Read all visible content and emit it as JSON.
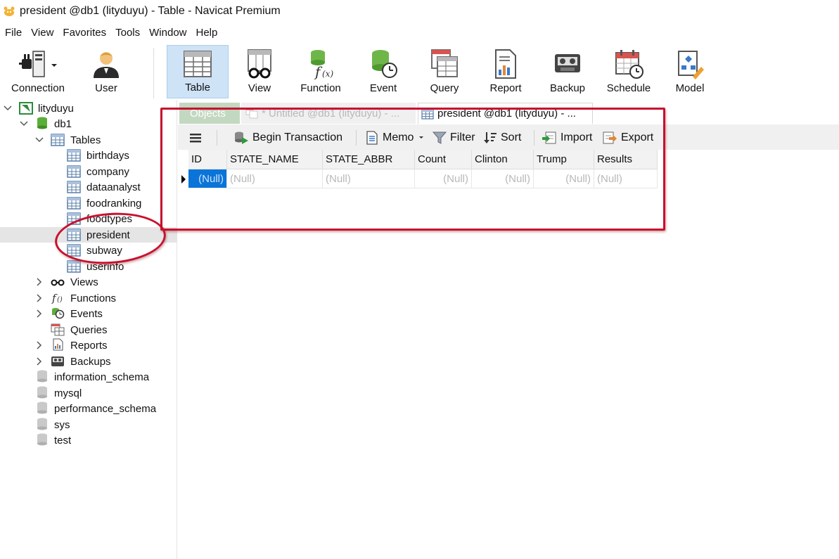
{
  "window": {
    "title": "president @db1 (lityduyu) - Table - Navicat Premium"
  },
  "menu": [
    "File",
    "View",
    "Favorites",
    "Tools",
    "Window",
    "Help"
  ],
  "toolbar": {
    "connection": "Connection",
    "user": "User",
    "table": "Table",
    "view": "View",
    "function": "Function",
    "event": "Event",
    "query": "Query",
    "report": "Report",
    "backup": "Backup",
    "schedule": "Schedule",
    "model": "Model"
  },
  "tree": {
    "connection": "lityduyu",
    "database": "db1",
    "tables_label": "Tables",
    "tables": [
      "birthdays",
      "company",
      "dataanalyst",
      "foodranking",
      "foodtypes",
      "president",
      "subway",
      "userinfo"
    ],
    "selected_table": "president",
    "groups": [
      "Views",
      "Functions",
      "Events",
      "Queries",
      "Reports",
      "Backups"
    ],
    "other_databases": [
      "information_schema",
      "mysql",
      "performance_schema",
      "sys",
      "test"
    ]
  },
  "tabs": {
    "objects": "Objects",
    "untitled": "* Untitled @db1 (lityduyu) - ...",
    "president": "president @db1 (lityduyu) - ..."
  },
  "table_toolbar": {
    "begin_transaction": "Begin Transaction",
    "memo": "Memo",
    "filter": "Filter",
    "sort": "Sort",
    "import": "Import",
    "export": "Export"
  },
  "grid": {
    "columns": [
      "ID",
      "STATE_NAME",
      "STATE_ABBR",
      "Count",
      "Clinton",
      "Trump",
      "Results"
    ],
    "rows": [
      [
        "(Null)",
        "(Null)",
        "(Null)",
        "(Null)",
        "(Null)",
        "(Null)",
        "(Null)"
      ]
    ]
  },
  "colors": {
    "annotation": "#c8102e",
    "selection": "#0a74d9",
    "active_tool": "#cfe3f7",
    "objects_tab": "#c3d8c0"
  }
}
